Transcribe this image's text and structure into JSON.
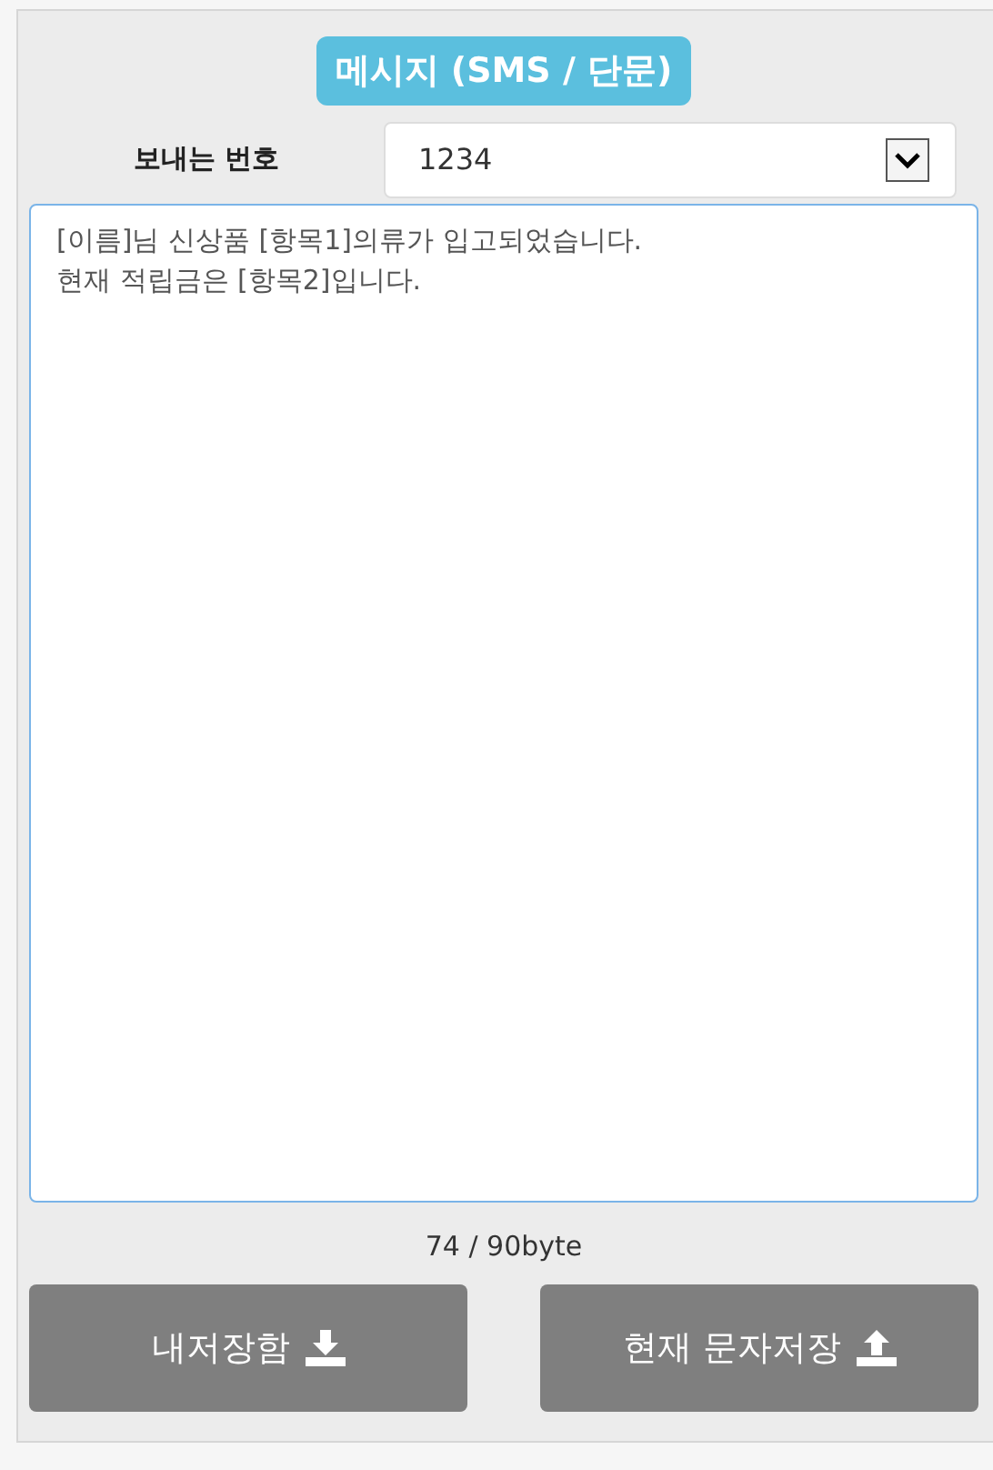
{
  "title": "메시지 (SMS / 단문)",
  "sender": {
    "label": "보내는 번호",
    "value": "1234"
  },
  "message": {
    "value": "[이름]님 신상품 [항목1]의류가 입고되었습니다.\n현재 적립금은 [항목2]입니다."
  },
  "counter": "74 / 90byte",
  "buttons": [
    {
      "label": "내저장함",
      "kind": "download"
    },
    {
      "label": "현재 문자저장",
      "kind": "upload"
    }
  ]
}
